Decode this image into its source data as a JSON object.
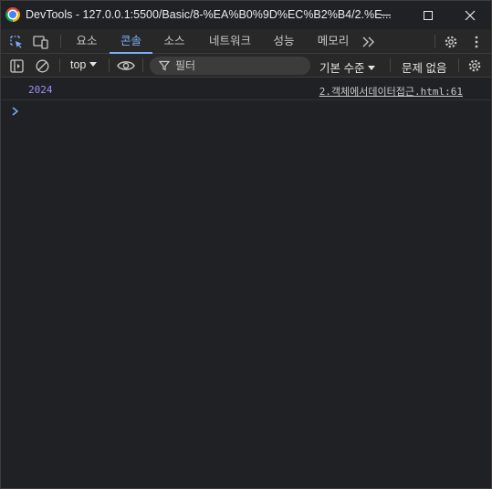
{
  "window": {
    "title": "DevTools - 127.0.0.1:5500/Basic/8-%EA%B0%9D%EC%B2%B4/2.%E..."
  },
  "tabs": [
    {
      "label": "요소",
      "active": false
    },
    {
      "label": "콘솔",
      "active": true
    },
    {
      "label": "소스",
      "active": false
    },
    {
      "label": "네트워크",
      "active": false
    },
    {
      "label": "성능",
      "active": false
    },
    {
      "label": "메모리",
      "active": false
    }
  ],
  "console_toolbar": {
    "context": "top",
    "filter_placeholder": "필터",
    "log_level": "기본 수준",
    "issues": "문제 없음"
  },
  "console": {
    "messages": [
      {
        "value": "2024",
        "source": "2.객체에서데이터접근.html:61"
      }
    ]
  },
  "colors": {
    "background": "#202124",
    "toolbar": "#282828",
    "accent": "#7cacf8",
    "number_value": "#9d8ff3"
  },
  "icons": [
    "chrome-logo-icon",
    "inspect-element-icon",
    "device-toolbar-icon",
    "more-tabs-icon",
    "settings-icon",
    "more-options-icon",
    "sidebar-toggle-icon",
    "clear-console-icon",
    "eye-icon",
    "filter-icon",
    "prompt-chevron-icon"
  ]
}
